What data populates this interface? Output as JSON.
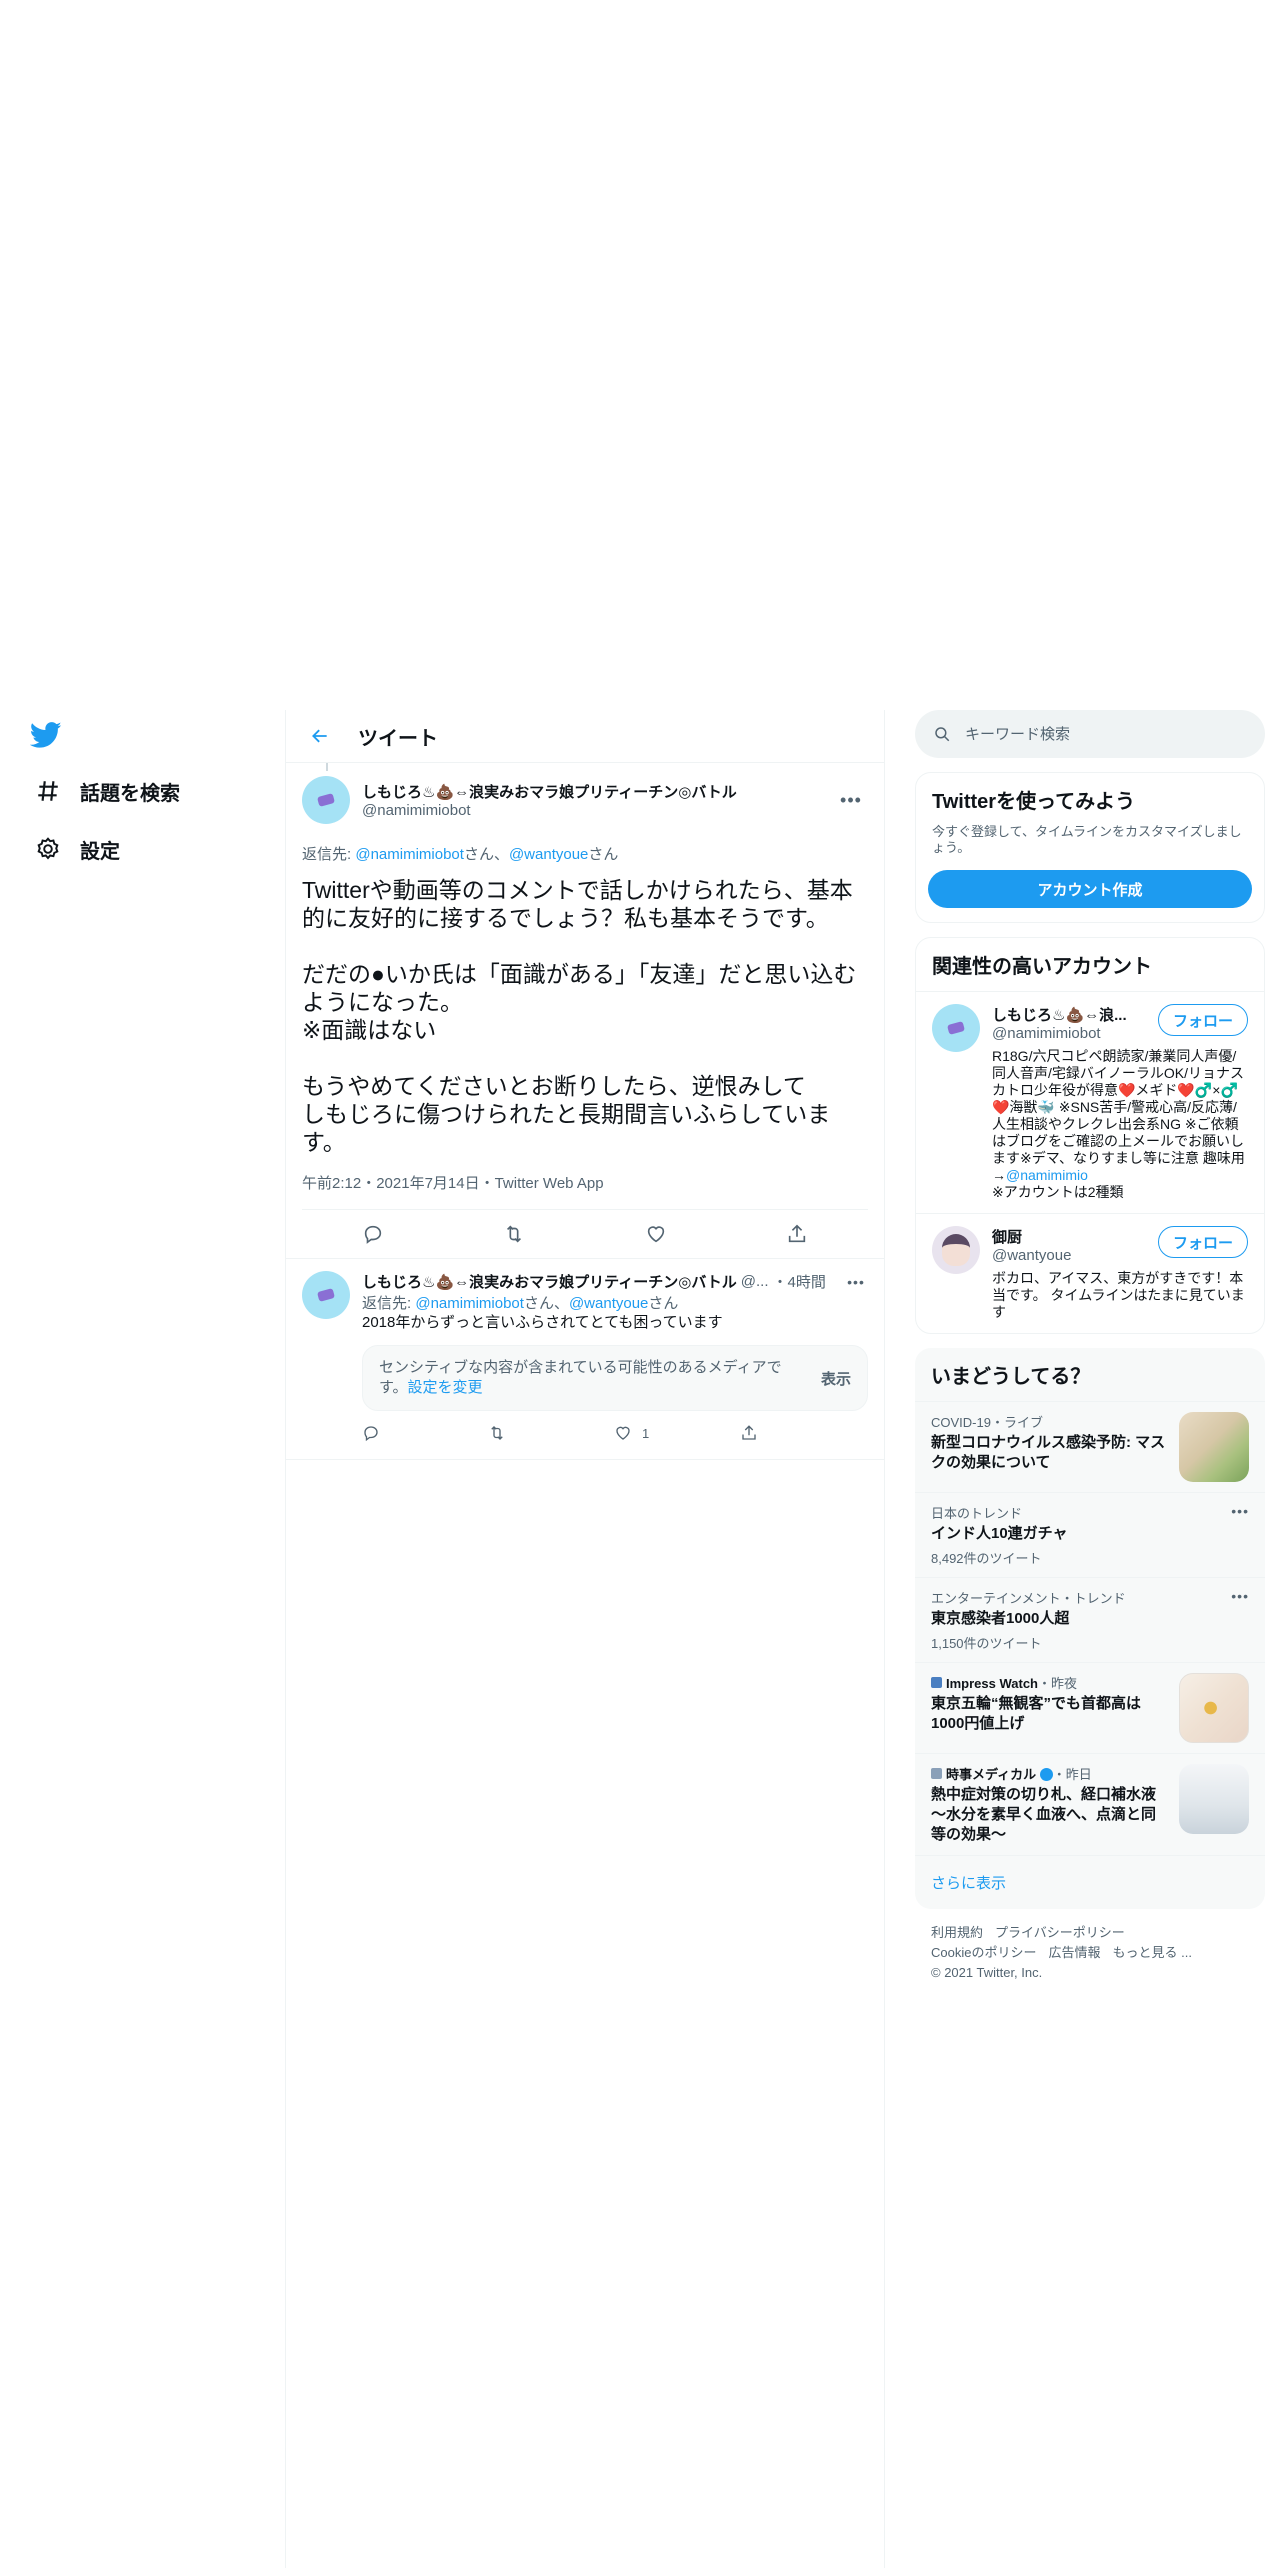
{
  "nav": {
    "explore_label": "話題を検索",
    "settings_label": "設定"
  },
  "header": {
    "title": "ツイート"
  },
  "main_tweet": {
    "author_name": "しもじろ♨💩⇔浪実みおマラ娘プリティーチン◎バトル",
    "author_handle": "@namimimiobot",
    "reply_prefix": "返信先: ",
    "reply_to_1": "@namimimiobot",
    "reply_sep": "さん、",
    "reply_to_2": "@wantyoue",
    "reply_suffix": "さん",
    "text": "Twitterや動画等のコメントで話しかけられたら、基本的に友好的に接するでしょう？私も基本そうです。\n\nだだの●いか氏は「面識がある」「友達」だと思い込むようになった。\n※面識はない\n\nもうやめてくださいとお断りしたら、逆恨みして\nしもじろに傷つけられたと長期間言いふらしています。",
    "meta": "午前2:12・2021年7月14日・Twitter Web App"
  },
  "reply_tweet": {
    "author_name": "しもじろ♨💩⇔浪実みおマラ娘プリティーチン◎バトル",
    "author_handle": "@...",
    "time": "・4時間",
    "reply_prefix": "返信先: ",
    "reply_to_1": "@namimimiobot",
    "reply_sep": "さん、",
    "reply_to_2": "@wantyoue",
    "reply_suffix": "さん",
    "text": "2018年からずっと言いふらされてとても困っています",
    "sensitive_msg": "センシティブな内容が含まれている可能性のあるメディアです。",
    "sensitive_link": "設定を変更",
    "show_label": "表示",
    "like_count": "1"
  },
  "search": {
    "placeholder": "キーワード検索"
  },
  "signup": {
    "title": "Twitterを使ってみよう",
    "desc": "今すぐ登録して、タイムラインをカスタマイズしましょう。",
    "button": "アカウント作成"
  },
  "who_to_follow": {
    "title": "関連性の高いアカウント",
    "follow_label": "フォロー",
    "accounts": [
      {
        "name": "しもじろ♨💩⇔浪...",
        "handle": "@namimimiobot",
        "bio": "R18G/六尺コピペ朗読家/兼業同人声優/同人音声/宅録バイノーラルOK/リョナスカトロ少年役が得意❤️メギド❤️♂️×♂️❤️海獣🐳 ※SNS苦手/警戒心高/反応薄/人生相談やクレクレ出会系NG ※ご依頼はブログをご確認の上メールでお願いします※デマ、なりすまし等に注意 趣味用→",
        "bio_link": "@namimimio",
        "bio_tail": "※アカウントは2種類"
      },
      {
        "name": "御厨",
        "handle": "@wantyoue",
        "bio": "ボカロ、アイマス、東方がすきです！本当です。 タイムラインはたまに見ています"
      }
    ]
  },
  "trends": {
    "title": "いまどうしてる？",
    "items": [
      {
        "category": "COVID-19・ライブ",
        "title": "新型コロナウイルス感染予防: マスクの効果について"
      },
      {
        "category": "日本のトレンド",
        "title": "インド人10連ガチャ",
        "count": "8,492件のツイート"
      },
      {
        "category": "エンターテインメント・トレンド",
        "title": "東京感染者1000人超",
        "count": "1,150件のツイート"
      },
      {
        "category_source": "Impress Watch",
        "category": "・昨夜",
        "title": "東京五輪“無観客”でも首都高は1000円値上げ"
      },
      {
        "category_source": "時事メディカル",
        "category": "・昨日",
        "title": "熱中症対策の切り札、経口補水液～水分を素早く血液へ、点滴と同等の効果～"
      }
    ],
    "show_more": "さらに表示"
  },
  "footer": {
    "links": [
      "利用規約",
      "プライバシーポリシー",
      "Cookieのポリシー",
      "広告情報",
      "もっと見る ..."
    ],
    "copyright": "© 2021 Twitter, Inc."
  },
  "colors": {
    "accent": "#1d9bf0",
    "secondary_text": "#536471",
    "border": "#eff3f4"
  }
}
